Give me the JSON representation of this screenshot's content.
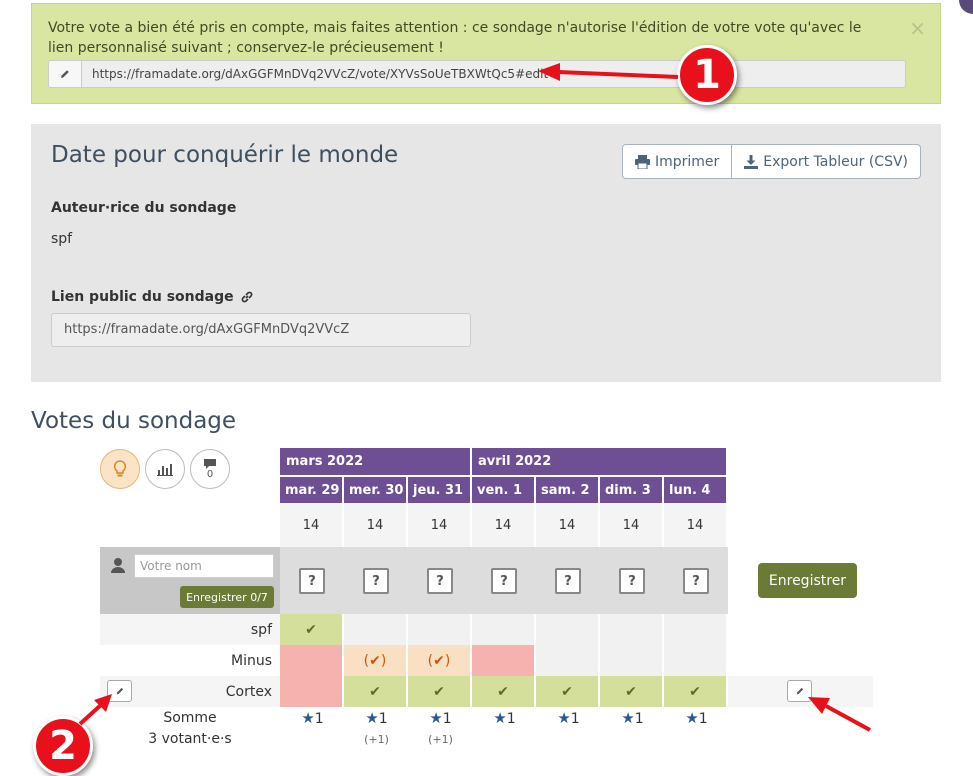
{
  "alert": {
    "message": "Votre vote a bien été pris en compte, mais faites attention : ce sondage n'autorise l'édition de votre vote qu'avec le lien personnalisé suivant ; conservez-le précieusement !",
    "close": "×",
    "edit_link": "https://framadate.org/dAxGGFMnDVq2VVcZ/vote/XYVsSoUeTBXWtQc5#edit"
  },
  "annotations": {
    "badge1": "1",
    "badge2": "2"
  },
  "poll": {
    "title": "Date pour conquérir le monde",
    "print_label": "Imprimer",
    "export_label": "Export Tableur (CSV)",
    "author_label": "Auteur·rice du sondage",
    "author": "spf",
    "public_link_label": "Lien public du sondage",
    "public_link": "https://framadate.org/dAxGGFMnDVq2VVcZ"
  },
  "votes": {
    "title": "Votes du sondage",
    "comments_count": "0",
    "months": [
      "mars 2022",
      "avril 2022"
    ],
    "days": [
      "mar. 29",
      "mer. 30",
      "jeu. 31",
      "ven. 1",
      "sam. 2",
      "dim. 3",
      "lun. 4"
    ],
    "hours": [
      "14",
      "14",
      "14",
      "14",
      "14",
      "14",
      "14"
    ],
    "name_placeholder": "Votre nom",
    "save_small_label": "Enregistrer 0/7",
    "save_label": "Enregistrer",
    "question_mark": "?",
    "rows": [
      {
        "name": "spf",
        "votes": [
          "yes",
          "",
          "",
          "",
          "",
          "",
          ""
        ]
      },
      {
        "name": "Minus",
        "votes": [
          "no",
          "maybe",
          "maybe",
          "no",
          "",
          "",
          ""
        ]
      },
      {
        "name": "Cortex",
        "votes": [
          "no",
          "yes",
          "yes",
          "yes",
          "yes",
          "yes",
          "yes"
        ]
      }
    ],
    "yes_symbol": "✔",
    "maybe_symbol": "(✔)",
    "sum_label": "Somme",
    "voters_label": "3 votant·e·s",
    "sums": [
      "1",
      "1",
      "1",
      "1",
      "1",
      "1",
      "1"
    ],
    "sum_extras": [
      "",
      "(+1)",
      "(+1)",
      "",
      "",
      "",
      ""
    ]
  },
  "colors": {
    "alert_bg": "#d9e6a1",
    "header_purple": "#6f4f93",
    "save_green": "#6b7b36",
    "yes": "#d4df9b",
    "no": "#f5b2ae",
    "maybe": "#fae0c2",
    "badge_red": "#e8101b"
  }
}
